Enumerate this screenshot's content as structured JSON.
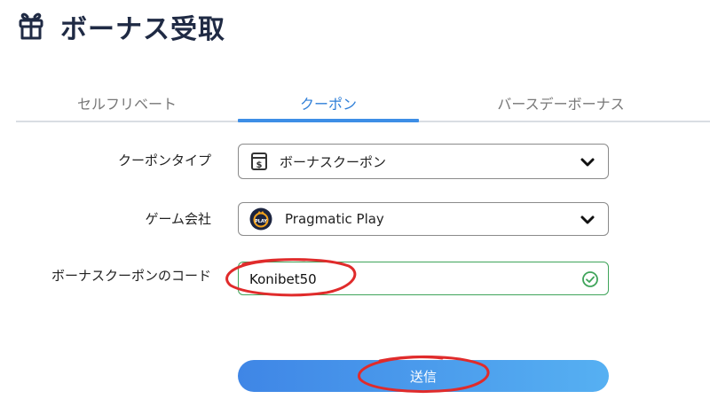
{
  "header": {
    "title": "ボーナス受取",
    "icon": "gift-box-icon"
  },
  "tabs": [
    {
      "label": "セルフリベート",
      "active": false
    },
    {
      "label": "クーポン",
      "active": true
    },
    {
      "label": "バースデーボーナス",
      "active": false
    }
  ],
  "form": {
    "coupon_type": {
      "label": "クーポンタイプ",
      "value": "ボーナスクーポン",
      "icon": "coupon-dollar-icon"
    },
    "game_company": {
      "label": "ゲーム会社",
      "value": "Pragmatic Play",
      "icon": "pragmatic-play-logo-icon"
    },
    "coupon_code": {
      "label": "ボーナスクーポンのコード",
      "value": "Konibet50",
      "status_icon": "check-circle-icon"
    }
  },
  "submit": {
    "label": "送信"
  },
  "colors": {
    "accent": "#3d8ee6",
    "title": "#1f2a44",
    "valid": "#3fa45a",
    "annotation": "#e02b2b"
  }
}
